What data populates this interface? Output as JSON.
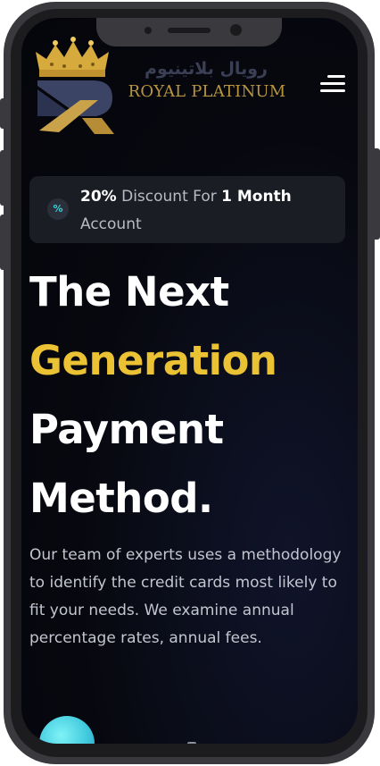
{
  "header": {
    "brand_arabic": "رويال بلاتينيوم",
    "brand_latin": "ROYAL PLATINUM",
    "logo_icon": "royal-crown-r-logo",
    "menu_icon": "hamburger-menu-icon"
  },
  "promo": {
    "icon": "percent-icon",
    "icon_glyph": "%",
    "percent": "20%",
    "middle": " Discount For ",
    "duration": "1 Month",
    "tail": " Account"
  },
  "hero": {
    "line1": "The Next",
    "line2": "Generation",
    "line3": "Payment",
    "line4": "Method."
  },
  "description": "Our team of experts uses a methodology to identify the credit cards most likely to fit your needs. We examine annual percentage rates, annual fees.",
  "colors": {
    "background": "#07080f",
    "accent_gold": "#ebc233",
    "brand_gold": "#b8953e",
    "promo_bg": "#1b1d25",
    "icon_teal": "#35d0d8",
    "device_frame": "#3a3a3e"
  }
}
